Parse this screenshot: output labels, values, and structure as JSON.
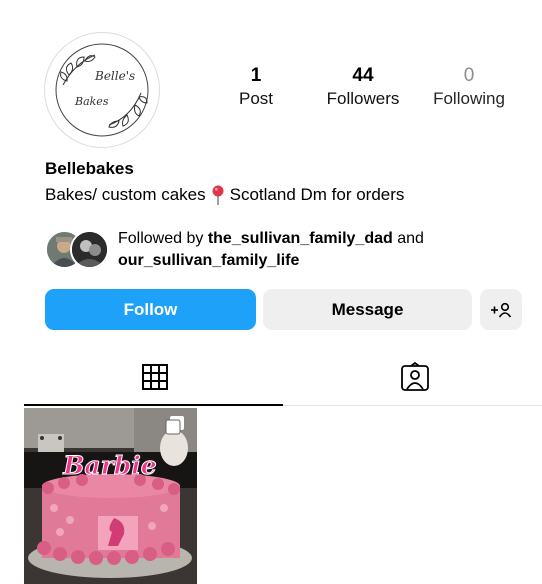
{
  "profile": {
    "avatar_text_line1": "Belle's",
    "avatar_text_line2": "Bakes",
    "username": "Bellebakes",
    "bio_before": "Bakes/ custom cakes",
    "bio_after": "Scotland Dm for orders"
  },
  "stats": {
    "posts_count": "1",
    "posts_label": "Post",
    "followers_count": "44",
    "followers_label": "Followers",
    "following_count": "0",
    "following_label": "Following"
  },
  "followed_by": {
    "prefix": "Followed by",
    "user1": "the_sullivan_family_dad",
    "conjunction": "and",
    "user2": "our_sullivan_family_life"
  },
  "buttons": {
    "follow": "Follow",
    "message": "Message",
    "add_person": "+ʘ"
  },
  "tabs": [
    "grid-icon",
    "tagged-icon"
  ],
  "post": {
    "cake_text": "Barbie"
  },
  "colors": {
    "follow_blue": "#1ea1f8",
    "button_gray": "#efefef",
    "cake_pink": "#e66a8f"
  }
}
